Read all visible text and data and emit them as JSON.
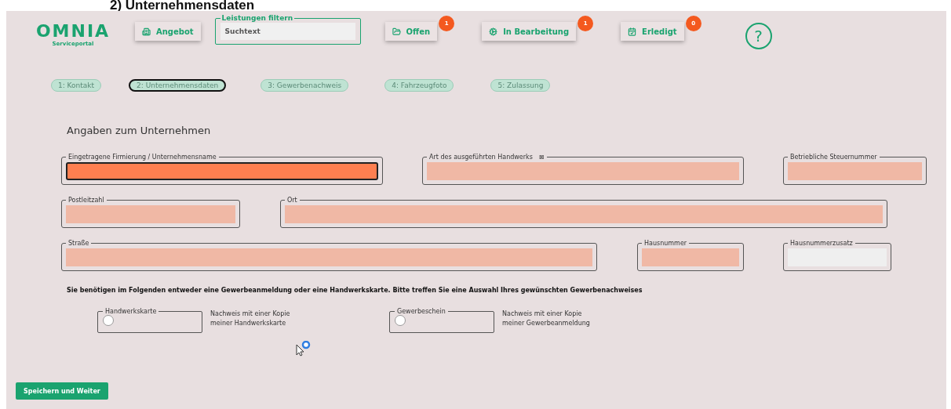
{
  "page_title": "2)  Unternehmensdaten",
  "logo": {
    "name": "OMNIA",
    "subtitle": "Serviceportal"
  },
  "header": {
    "offer_button": "Angebot",
    "filter": {
      "legend": "Leistungen filtern",
      "placeholder": "Suchtext"
    },
    "status_buttons": [
      {
        "kind": "open",
        "label": "Offen",
        "count": "1"
      },
      {
        "kind": "progress",
        "label": "In Bearbeitung",
        "count": "1"
      },
      {
        "kind": "done",
        "label": "Erledigt",
        "count": "0"
      }
    ],
    "help": "?"
  },
  "steps": [
    {
      "label": "1: Kontakt",
      "selected": false
    },
    {
      "label": "2: Unternehmensdaten",
      "selected": true
    },
    {
      "label": "3: Gewerbenachweis",
      "selected": false
    },
    {
      "label": "4: Fahrzeugfoto",
      "selected": false
    },
    {
      "label": "5: Zulassung",
      "selected": false
    }
  ],
  "section_title": "Angaben zum Unternehmen",
  "field_rows": [
    [
      {
        "label": "Eingetragene Firmierung / Unternehmensname",
        "focused": true,
        "required": true
      },
      {
        "label": "Art des ausgeführten Handwerks",
        "info_mark": "⊠",
        "focused": false,
        "required": true
      },
      {
        "label": "Betriebliche Steuernummer",
        "focused": false,
        "required": true
      }
    ],
    [
      {
        "label": "Postleitzahl",
        "focused": false,
        "required": true
      },
      {
        "label": "Ort",
        "focused": false,
        "required": true
      }
    ],
    [
      {
        "label": "Straße",
        "focused": false,
        "required": true
      },
      {
        "label": "Hausnummer",
        "focused": false,
        "required": true
      },
      {
        "label": "Hausnummerzusatz",
        "focused": false,
        "required": false
      }
    ]
  ],
  "notice": "Sie benötigen im Folgenden entweder eine Gewerbeanmeldung oder eine Handwerkskarte. Bitte treffen Sie eine Auswahl Ihres gewünschten Gewerbenachweises",
  "proof_options": [
    {
      "label": "Handwerkskarte",
      "selected": false,
      "description": [
        "Nachweis mit einer Kopie",
        "meiner Handwerkskarte"
      ]
    },
    {
      "label": "Gewerbeschein",
      "selected": false,
      "description": [
        "Nachweis mit einer Kopie",
        "meiner Gewerbeanmeldung"
      ]
    }
  ],
  "save_button": "Speichern und Weiter"
}
